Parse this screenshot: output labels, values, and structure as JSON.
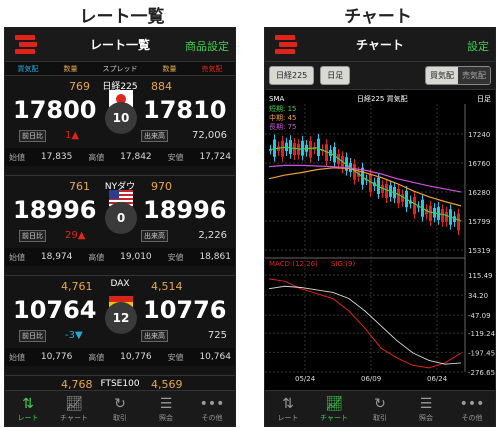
{
  "captions": {
    "left": "レート一覧",
    "right": "チャート"
  },
  "rates": {
    "title": "レート一覧",
    "settings": "商品設定",
    "legend": {
      "bid": "買気配",
      "qty": "数量",
      "spread": "スプレッド",
      "ask_qty": "数量",
      "ask": "売気配"
    },
    "labels": {
      "prev": "前日比",
      "volume": "出来高",
      "open": "始値",
      "high": "高値",
      "low": "安値"
    },
    "items": [
      {
        "name": "日経225",
        "spread_l": "769",
        "spread_r": "884",
        "bid": "17800",
        "ask": "17810",
        "spread": "10",
        "change": "1▲",
        "volume": "72,006",
        "open": "17,835",
        "high": "17,842",
        "low": "17,724"
      },
      {
        "name": "NYダウ",
        "spread_l": "761",
        "spread_r": "970",
        "bid": "18996",
        "ask": "18996",
        "spread": "0",
        "change": "29▲",
        "volume": "2,226",
        "open": "18,974",
        "high": "19,010",
        "low": "18,861"
      },
      {
        "name": "DAX",
        "spread_l": "4,761",
        "spread_r": "4,514",
        "bid": "10764",
        "ask": "10776",
        "spread": "12",
        "change": "-3▼",
        "volume": "725",
        "open": "10,776",
        "high": "10,776",
        "low": "10,764"
      },
      {
        "name": "FTSE100",
        "spread_l": "4,768",
        "spread_r": "4,569"
      }
    ]
  },
  "chartscreen": {
    "title": "チャート",
    "settings": "設定",
    "symbol": "日経225",
    "period": "日足",
    "bid": "買気配",
    "ask": "売気配",
    "header": "日経225 買気配",
    "foot": "日足",
    "sma": "SMA",
    "sma_short": "短期: 15",
    "sma_mid": "中期: 45",
    "sma_long": "長期: 75",
    "macd": "MACD:(12,26)",
    "sig": "SIG:(9)"
  },
  "tabs": {
    "left": [
      "レート",
      "チャート",
      "取引",
      "照会",
      "その他"
    ],
    "right": [
      "レート",
      "チャート",
      "取引",
      "照会",
      "その他"
    ]
  },
  "chart_data": {
    "type": "line",
    "price_axis": [
      "17240",
      "16760",
      "16280",
      "15799",
      "15319"
    ],
    "macd_axis": [
      "115.49",
      "34.20",
      "-47.09",
      "-119.24",
      "-197.45",
      "-276.65"
    ],
    "x": [
      "05/24",
      "06/09",
      "06/24"
    ],
    "series": [
      {
        "name": "短期: 15",
        "values": [
          16980,
          17020,
          16990,
          17010,
          16900,
          16700,
          16500,
          16350,
          16250,
          16100,
          15950,
          15900,
          15800
        ]
      },
      {
        "name": "中期: 45",
        "values": [
          16500,
          16560,
          16600,
          16650,
          16680,
          16670,
          16600,
          16520,
          16420,
          16300,
          16200,
          16120,
          16050
        ]
      },
      {
        "name": "長期: 75",
        "values": [
          16700,
          16720,
          16720,
          16710,
          16700,
          16680,
          16640,
          16580,
          16500,
          16440,
          16380,
          16330,
          16280
        ]
      }
    ],
    "macd": [
      100,
      90,
      60,
      40,
      20,
      -30,
      -100,
      -180,
      -220,
      -250,
      -260,
      -240,
      -200
    ],
    "signal": [
      60,
      70,
      65,
      55,
      45,
      20,
      -30,
      -90,
      -150,
      -200,
      -230,
      -245,
      -240
    ]
  },
  "colors": {
    "accent_green": "#3fcf4f",
    "up_red": "#e0241b",
    "down_blue": "#26a7e0",
    "spread_orange": "#e8a84a"
  }
}
